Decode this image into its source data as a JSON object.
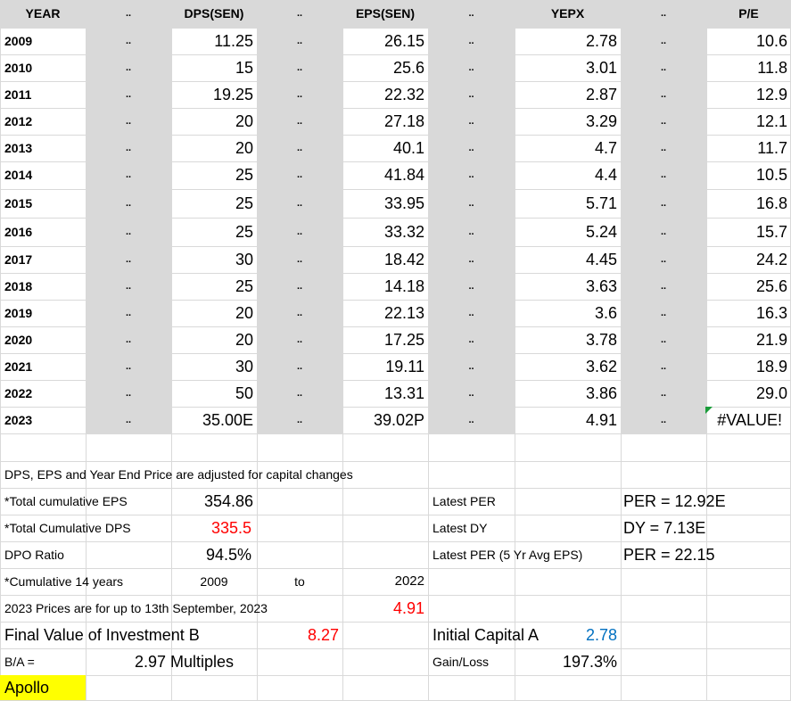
{
  "headers": [
    "YEAR",
    "..",
    "DPS(SEN)",
    "..",
    "EPS(SEN)",
    "..",
    "YEPX",
    "..",
    "P/E"
  ],
  "dots": "..",
  "rows": [
    {
      "year": "2009",
      "dps": "11.25",
      "eps": "26.15",
      "yepx": "2.78",
      "pe": "10.6"
    },
    {
      "year": "2010",
      "dps": "15",
      "eps": "25.6",
      "yepx": "3.01",
      "pe": "11.8"
    },
    {
      "year": "2011",
      "dps": "19.25",
      "eps": "22.32",
      "yepx": "2.87",
      "pe": "12.9"
    },
    {
      "year": "2012",
      "dps": "20",
      "eps": "27.18",
      "yepx": "3.29",
      "pe": "12.1"
    },
    {
      "year": "2013",
      "dps": "20",
      "eps": "40.1",
      "yepx": "4.7",
      "pe": "11.7"
    },
    {
      "year": "2014",
      "dps": "25",
      "eps": "41.84",
      "yepx": "4.4",
      "pe": "10.5"
    },
    {
      "year": "2015",
      "dps": "25",
      "eps": "33.95",
      "yepx": "5.71",
      "pe": "16.8"
    },
    {
      "year": "2016",
      "dps": "25",
      "eps": "33.32",
      "yepx": "5.24",
      "pe": "15.7"
    },
    {
      "year": "2017",
      "dps": "30",
      "eps": "18.42",
      "yepx": "4.45",
      "pe": "24.2"
    },
    {
      "year": "2018",
      "dps": "25",
      "eps": "14.18",
      "yepx": "3.63",
      "pe": "25.6"
    },
    {
      "year": "2019",
      "dps": "20",
      "eps": "22.13",
      "yepx": "3.6",
      "pe": "16.3"
    },
    {
      "year": "2020",
      "dps": "20",
      "eps": "17.25",
      "yepx": "3.78",
      "pe": "21.9"
    },
    {
      "year": "2021",
      "dps": "30",
      "eps": "19.11",
      "yepx": "3.62",
      "pe": "18.9"
    },
    {
      "year": "2022",
      "dps": "50",
      "eps": "13.31",
      "yepx": "3.86",
      "pe": "29.0"
    },
    {
      "year": "2023",
      "dps": "35.00E",
      "eps": "39.02P",
      "yepx": "4.91",
      "pe": "#VALUE!"
    }
  ],
  "summary": {
    "note": "DPS, EPS and Year End Price are adjusted for capital changes",
    "total_eps_label": "*Total cumulative EPS",
    "total_eps_value": "354.86",
    "total_dps_label": "*Total Cumulative DPS",
    "total_dps_value": "335.5",
    "dpo_label": "DPO Ratio",
    "dpo_value": "94.5%",
    "cumulative_label": "*Cumulative 14 years",
    "cumulative_from": "2009",
    "cumulative_to_word": "to",
    "cumulative_to": "2022",
    "prices_note": "2023 Prices are for up to 13th September, 2023",
    "prices_value": "4.91",
    "final_value_label": "Final Value of Investment B",
    "final_value": "8.27",
    "ba_label": "B/A =",
    "ba_value": "2.97 Multiples",
    "stock_name": "Apollo",
    "latest_per_label": "Latest PER",
    "latest_per_value": "PER = 12.92E",
    "latest_dy_label": "Latest DY",
    "latest_dy_value": "DY = 7.13E",
    "latest_per5_label": "Latest PER (5 Yr Avg EPS)",
    "latest_per5_value": "PER = 22.15",
    "initial_capital_label": "Initial Capital A",
    "initial_capital_value": "2.78",
    "gain_loss_label": "Gain/Loss",
    "gain_loss_value": "197.3%"
  },
  "colors": {
    "shade": "#d9d9d9",
    "red": "#ff0000",
    "blue": "#0070c0",
    "highlight": "#ffff00",
    "error_flag": "#1a9c3a"
  }
}
